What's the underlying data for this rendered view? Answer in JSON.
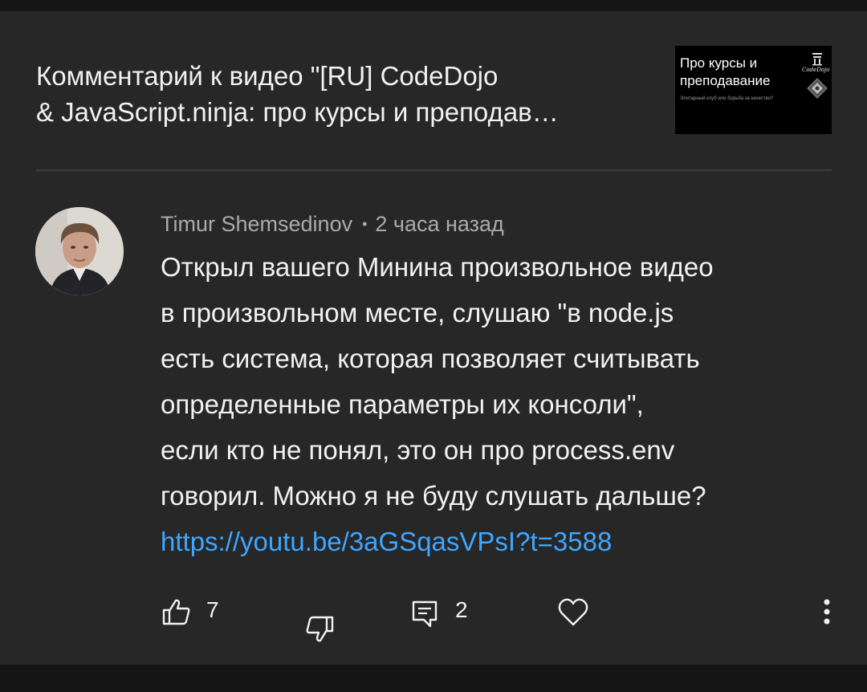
{
  "video": {
    "title": "Комментарий к видео \"[RU] CodeDojo\n& JavaScript.ninja: про курсы и преподав…",
    "thumbnail": {
      "title": "Про курсы и\nпреподавание",
      "subtitle": "Элитарный клуб или борьба за качество?",
      "logo_text": "CodeDojo"
    }
  },
  "comment": {
    "author": "Timur Shemsedinov",
    "separator": "•",
    "time": "2 часа назад",
    "text": "Открыл вашего Минина произвольное видео\nв произвольном месте, слушаю \"в node.js\nесть система, которая позволяет считывать\nопределенные параметры их консоли\",\nесли кто не понял, это он про process.env\nговорил. Можно я не буду слушать дальше?\n",
    "link": "https://youtu.be/3aGSqasVPsI?t=3588",
    "likes": "7",
    "replies": "2"
  },
  "icons": {
    "like": "thumb-up-icon",
    "dislike": "thumb-down-icon",
    "reply": "comment-icon",
    "heart": "heart-icon",
    "more": "more-vert-icon"
  },
  "colors": {
    "background": "#151515",
    "card": "#272727",
    "text": "#f1f1f1",
    "secondary_text": "#aaaaaa",
    "link": "#3ea6ff"
  }
}
